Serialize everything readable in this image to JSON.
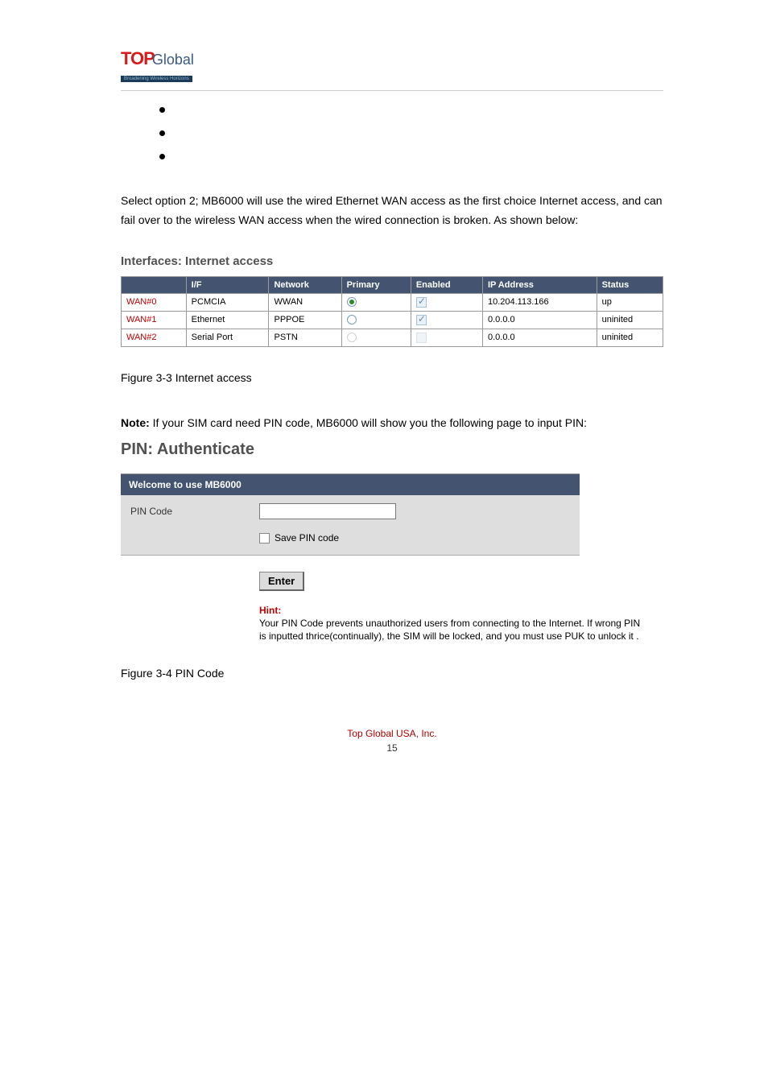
{
  "logo": {
    "red": "TOP",
    "blue": "Global",
    "tag": "Broadening Wireless Horizons"
  },
  "bullets": [
    "",
    "",
    ""
  ],
  "para1": "Select option 2; MB6000 will use the wired Ethernet WAN access as the first choice Internet access, and can fail over to the wireless WAN access when the wired connection is broken. As shown below:",
  "fig1_heading": "Interfaces: Internet access",
  "table1": {
    "headers": [
      "",
      "I/F",
      "Network",
      "Primary",
      "Enabled",
      "IP Address",
      "Status"
    ],
    "rows": [
      {
        "wan": "WAN#0",
        "if": "PCMCIA",
        "net": "WWAN",
        "primary": true,
        "enabled": true,
        "enabled_visible": true,
        "ip": "10.204.113.166",
        "status": "up"
      },
      {
        "wan": "WAN#1",
        "if": "Ethernet",
        "net": "PPPOE",
        "primary": false,
        "enabled": true,
        "enabled_visible": true,
        "ip": "0.0.0.0",
        "status": "uninited"
      },
      {
        "wan": "WAN#2",
        "if": "Serial Port",
        "net": "PSTN",
        "primary": false,
        "enabled": false,
        "enabled_visible": false,
        "ip": "0.0.0.0",
        "status": "uninited"
      }
    ]
  },
  "caption1": "Figure 3-3 Internet access",
  "note": {
    "label": "Note:",
    "text": " If your SIM card need PIN code, MB6000 will show you the following page to input PIN:"
  },
  "fig2_heading": "PIN: Authenticate",
  "pin": {
    "welcome": "Welcome to use MB6000",
    "label": "PIN Code",
    "value": "",
    "save_label": "Save PIN code",
    "enter": "Enter"
  },
  "hint": {
    "label": "Hint:",
    "text": "Your PIN Code prevents unauthorized users from connecting to the Internet. If wrong PIN is inputted thrice(continually), the SIM will be locked, and you must use PUK to unlock it ."
  },
  "caption2": "Figure 3-4 PIN Code",
  "footer": {
    "company": "Top Global USA, Inc.",
    "page": "15"
  }
}
